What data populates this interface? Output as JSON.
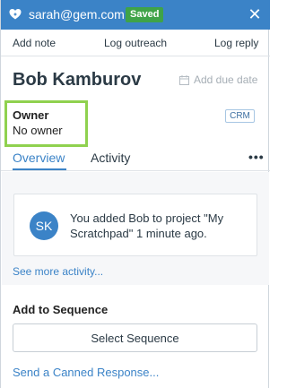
{
  "topbar": {
    "logo_icon": "heart-icon",
    "email": "sarah@gem.com",
    "status_badge": "Saved",
    "close_icon": "close-icon",
    "close_glyph": "✕",
    "bg_color": "#3b83c7",
    "badge_color": "#3fa348"
  },
  "actions": {
    "add_note": "Add note",
    "log_outreach": "Log outreach",
    "log_reply": "Log reply"
  },
  "profile": {
    "name": "Bob Kamburov",
    "due_date_label": "Add due date",
    "owner_label": "Owner",
    "owner_value": "No owner",
    "source_badge": "CRM"
  },
  "tabs": {
    "overview": "Overview",
    "activity": "Activity",
    "more_glyph": "•••",
    "active": "Overview"
  },
  "activity": {
    "avatar_initials": "SK",
    "message": "You added Bob to project \"My Scratchpad\" 1 minute ago.",
    "see_more": "See more activity..."
  },
  "sequence": {
    "title": "Add to Sequence",
    "select_button": "Select Sequence",
    "canned_link": "Send a Canned Response..."
  }
}
